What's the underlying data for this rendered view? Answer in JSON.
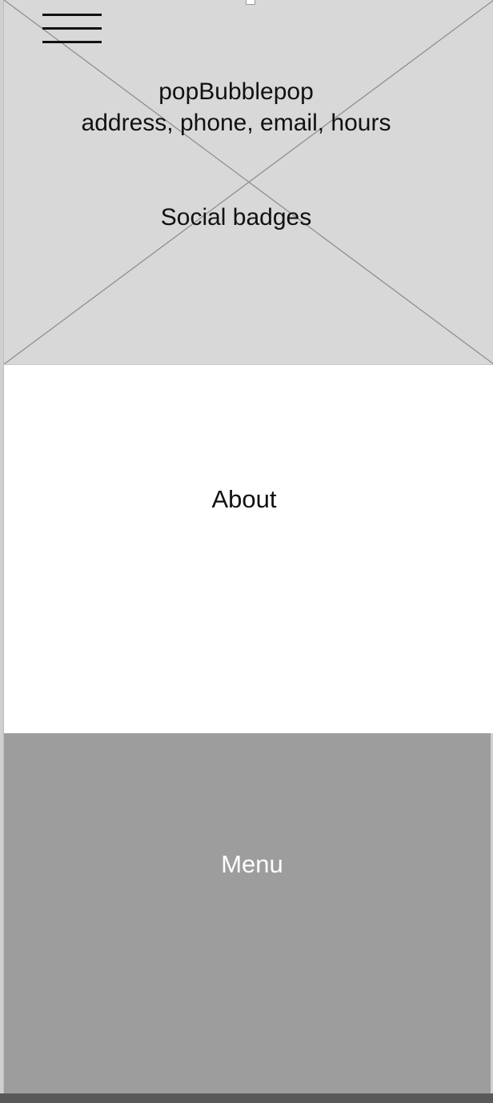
{
  "header": {
    "brand": "popBubblepop",
    "contact": "address, phone, email, hours",
    "social": "Social badges"
  },
  "about": {
    "label": "About"
  },
  "menu": {
    "label": "Menu"
  },
  "colors": {
    "header_bg": "#d8d8d8",
    "about_bg": "#ffffff",
    "menu_bg": "#9d9d9d",
    "menu_text": "#ffffff",
    "text": "#111111"
  }
}
